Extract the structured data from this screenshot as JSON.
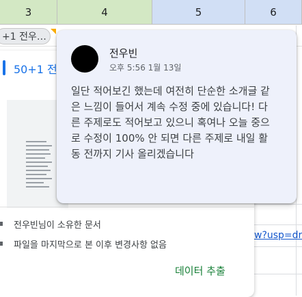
{
  "columns": [
    "3",
    "4",
    "5",
    "6"
  ],
  "cell_chip": "+1 전우…",
  "comment": {
    "author": "전우빈",
    "timestamp": "오후 5:56 1월 13일",
    "body": "일단 적어보긴 했는데 여전히 단순한 소개글 같은 느낌이 들어서 계속 수정 중에 있습니다! 다른 주제로도 적어보고 있으니 혹여나 오늘 중으로 수정이 100% 안 되면 다른 주제로 내일 활동 전까지 기사 올리겠습니다"
  },
  "preview": {
    "title": "50+1 전",
    "owner_text": "전우빈님이 소유한 문서",
    "change_text": "파일을 마지막으로 본 이후 변경사항 없음",
    "extract_button": "데이터 추출"
  },
  "sheet_link": "w?usp=dr",
  "colors": {
    "green_header": "#d3e8c4",
    "blue_header": "#d1dff5",
    "comment_bg": "#eef1fb",
    "accent_blue": "#1a73e8",
    "extract_green": "#188038"
  }
}
